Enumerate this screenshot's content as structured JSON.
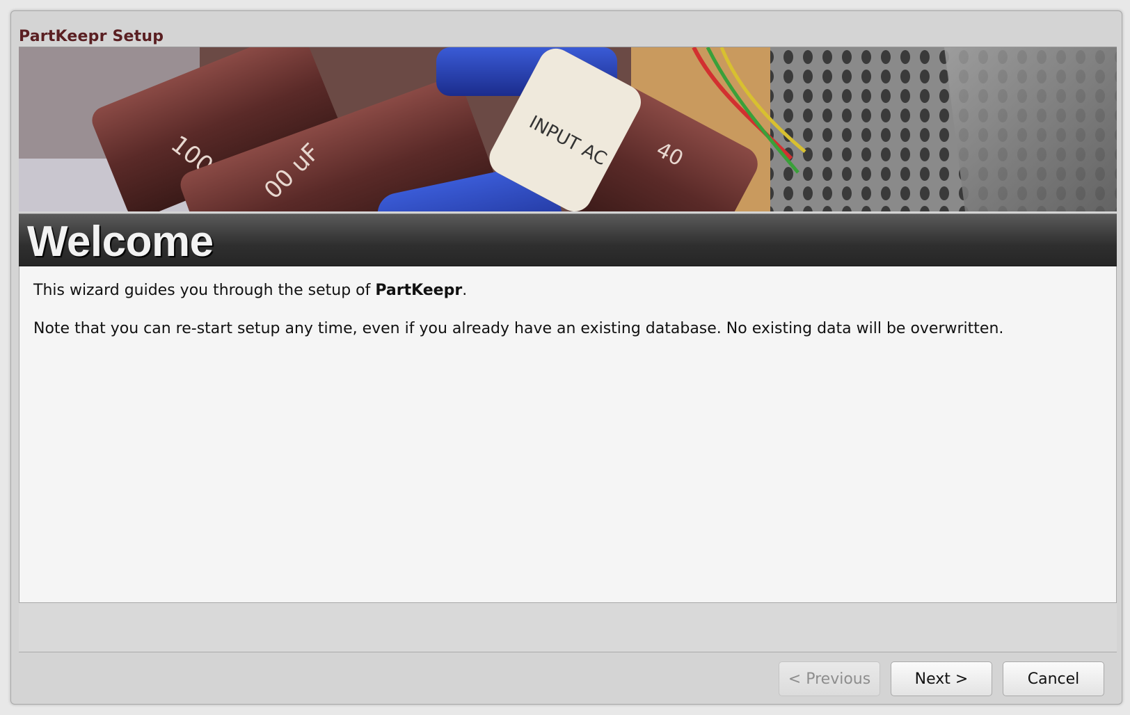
{
  "window": {
    "title": "PartKeepr Setup"
  },
  "banner": {
    "heading": "Welcome"
  },
  "content": {
    "intro_prefix": "This wizard guides you through the setup of ",
    "intro_app_name": "PartKeepr",
    "intro_suffix": ".",
    "note": "Note that you can re-start setup any time, even if you already have an existing database. No existing data will be overwritten."
  },
  "buttons": {
    "previous_label": "< Previous",
    "previous_enabled": false,
    "next_label": "Next >",
    "cancel_label": "Cancel"
  },
  "colors": {
    "title": "#5a1f22",
    "heading_bar": "#2f2f2f",
    "content_bg": "#f5f5f5",
    "window_bg": "#d4d4d4"
  },
  "icons": {
    "banner_image": "electronic-components-photo"
  }
}
